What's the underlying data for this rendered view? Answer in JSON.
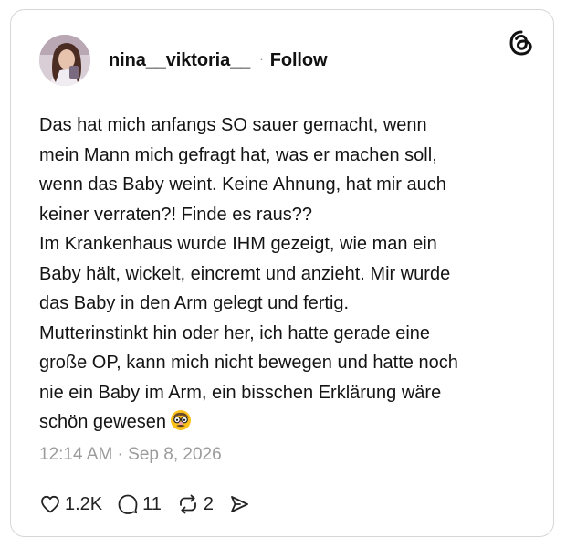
{
  "post": {
    "username": "nina__viktoria__",
    "separator": "·",
    "follow_label": "Follow",
    "text_lines": [
      "Das hat mich anfangs SO sauer gemacht, wenn",
      "mein Mann mich gefragt hat, was er machen soll,",
      "wenn das Baby weint. Keine Ahnung, hat mir auch",
      "keiner verraten?! Finde es raus??",
      "Im Krankenhaus wurde IHM gezeigt, wie man ein",
      "Baby hält, wickelt, eincremt und anzieht. Mir wurde",
      "das Baby in den Arm gelegt und fertig.",
      "Mutterinstinkt hin oder her, ich hatte gerade eine",
      "große OP, kann mich nicht bewegen und hatte noch",
      "nie ein Baby im Arm, ein bisschen Erklärung wäre",
      "schön gewesen"
    ],
    "emoji": "disguised-face-emoji",
    "timestamp": "12:14 AM · Sep 8, 2026",
    "likes": "1.2K",
    "replies": "11",
    "reposts": "2"
  },
  "icons": {
    "brand": "threads-logo-icon",
    "like": "heart-icon",
    "reply": "comment-bubble-icon",
    "repost": "repost-arrows-icon",
    "share": "send-icon"
  },
  "colors": {
    "text": "#111111",
    "muted": "#9b9b9b",
    "border": "#d6d6d6"
  }
}
